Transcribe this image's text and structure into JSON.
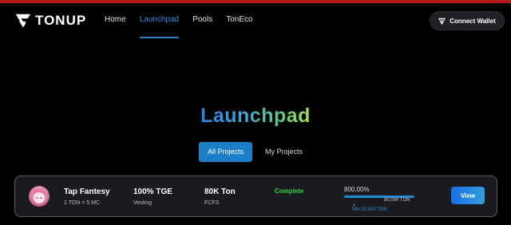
{
  "brand": {
    "name": "TONUP",
    "accent": "#2f7ccf",
    "top_bar_color": "#b3161b"
  },
  "nav": {
    "items": [
      {
        "label": "Home"
      },
      {
        "label": "Launchpad"
      },
      {
        "label": "Pools"
      },
      {
        "label": "TonEco"
      }
    ],
    "active": "Launchpad"
  },
  "wallet": {
    "label": "Connect Wallet",
    "icon": "ton-diamond-icon"
  },
  "page": {
    "title": "Launchpad"
  },
  "tabs": {
    "items": [
      {
        "label": "All Projects"
      },
      {
        "label": "My Projects"
      }
    ],
    "active": "All Projects"
  },
  "projects": [
    {
      "name": "Tap Fantesy",
      "rate": "1 TON = 5 MC",
      "tge": "100% TGE",
      "tge_sub": "Vesting",
      "raise": "80K Ton",
      "raise_sub": "FCFS",
      "status": "Complete",
      "status_color": "#36d04a",
      "progress_label": "800.00%",
      "progress_fraction": 1.0,
      "cap_label": "80,000 TON",
      "min_label": "Min:10,000 TON",
      "view_label": "View"
    }
  ]
}
